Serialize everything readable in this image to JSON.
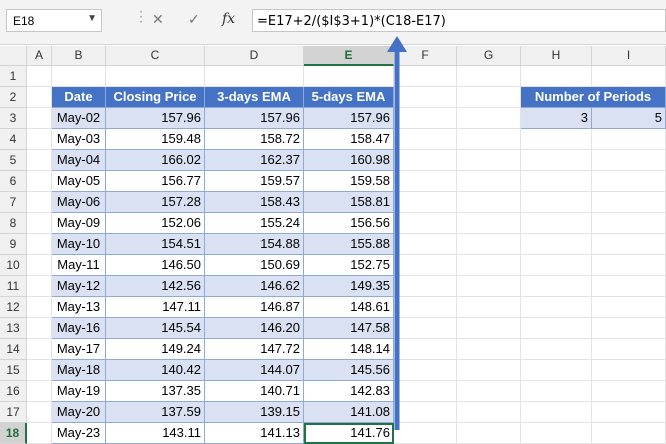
{
  "name_box": {
    "value": "E18"
  },
  "toolbar": {
    "cancel_symbol": "✕",
    "enter_symbol": "✓",
    "fx_label": "fx"
  },
  "formula_bar": {
    "value": "=E17+2/($I$3+1)*(C18-E17)"
  },
  "columns": [
    "A",
    "B",
    "C",
    "D",
    "E",
    "F",
    "G",
    "H",
    "I"
  ],
  "rows": [
    "1",
    "2",
    "3",
    "4",
    "5",
    "6",
    "7",
    "8",
    "9",
    "10",
    "11",
    "12",
    "13",
    "14",
    "15",
    "16",
    "17",
    "18"
  ],
  "selected_cell": {
    "column": "E",
    "row": "18"
  },
  "table": {
    "headers": [
      "Date",
      "Closing Price",
      "3-days EMA",
      "5-days EMA"
    ],
    "rows": [
      [
        "May-02",
        "157.96",
        "157.96",
        "157.96"
      ],
      [
        "May-03",
        "159.48",
        "158.72",
        "158.47"
      ],
      [
        "May-04",
        "166.02",
        "162.37",
        "160.98"
      ],
      [
        "May-05",
        "156.77",
        "159.57",
        "159.58"
      ],
      [
        "May-06",
        "157.28",
        "158.43",
        "158.81"
      ],
      [
        "May-09",
        "152.06",
        "155.24",
        "156.56"
      ],
      [
        "May-10",
        "154.51",
        "154.88",
        "155.88"
      ],
      [
        "May-11",
        "146.50",
        "150.69",
        "152.75"
      ],
      [
        "May-12",
        "142.56",
        "146.62",
        "149.35"
      ],
      [
        "May-13",
        "147.11",
        "146.87",
        "148.61"
      ],
      [
        "May-16",
        "145.54",
        "146.20",
        "147.58"
      ],
      [
        "May-17",
        "149.24",
        "147.72",
        "148.14"
      ],
      [
        "May-18",
        "140.42",
        "144.07",
        "145.56"
      ],
      [
        "May-19",
        "137.35",
        "140.71",
        "142.83"
      ],
      [
        "May-20",
        "137.59",
        "139.15",
        "141.08"
      ],
      [
        "May-23",
        "143.11",
        "141.13",
        "141.76"
      ]
    ]
  },
  "periods": {
    "header": "Number of Periods",
    "values": [
      "3",
      "5"
    ]
  },
  "colors": {
    "table_header": "#4472c4",
    "band": "#d9e1f2",
    "arrow": "#4472c4",
    "selection": "#217346"
  }
}
